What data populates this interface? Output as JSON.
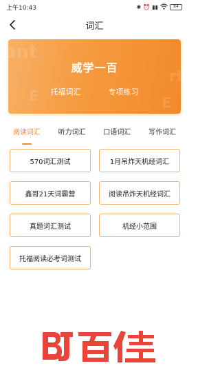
{
  "status": {
    "time": "上午10:43",
    "battery": "84"
  },
  "nav": {
    "title": "词汇"
  },
  "banner": {
    "title": "威学一百",
    "left": "托福词汇",
    "right": "专项练习"
  },
  "tabs": [
    {
      "label": "阅读词汇",
      "active": true
    },
    {
      "label": "听力词汇",
      "active": false
    },
    {
      "label": "口语词汇",
      "active": false
    },
    {
      "label": "写作词汇",
      "active": false
    }
  ],
  "items": [
    "570词汇测试",
    "1月吊炸天机经词汇",
    "鑫哥21天词霸营",
    "阅读吊炸天机经词汇",
    "真题词汇测试",
    "机经小范围",
    "托福阅读必考词测试"
  ],
  "colors": {
    "accent": "#f08a2c",
    "logo": "#e8443a"
  }
}
